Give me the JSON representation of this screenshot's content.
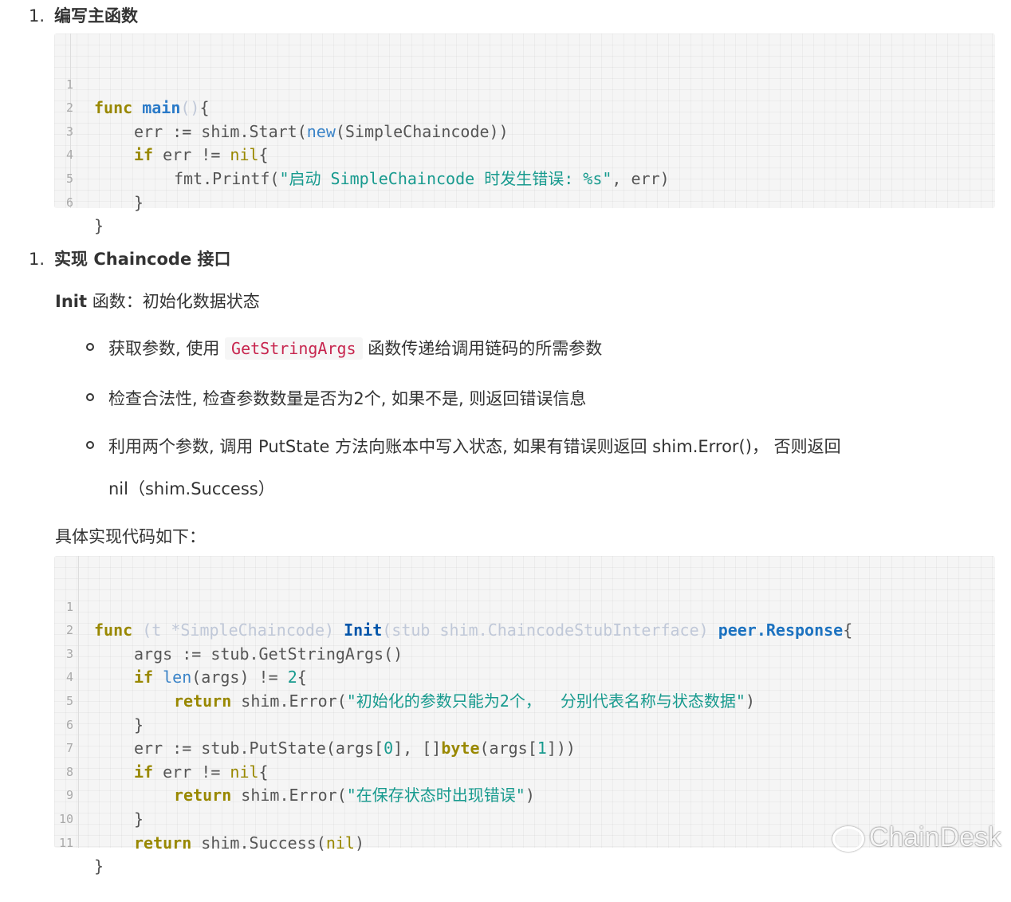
{
  "section1": {
    "number": "1.",
    "title": "编写主函数"
  },
  "code1": {
    "line_numbers": [
      "1",
      "2",
      "3",
      "4",
      "5",
      "6"
    ],
    "l1": {
      "kw": "func",
      "fn": "main",
      "parens": "()",
      "rest": "{"
    },
    "l2": {
      "a": "err := shim.Start(",
      "builtin": "new",
      "b": "(SimpleChaincode))"
    },
    "l3": {
      "kw": "if",
      "a": " err != ",
      "nil": "nil",
      "b": "{"
    },
    "l4": {
      "a": "fmt.Printf(",
      "str": "\"启动 SimpleChaincode 时发生错误: %s\"",
      "b": ", err)"
    },
    "l5": "}",
    "l6": "}"
  },
  "section2": {
    "number": "1.",
    "title": "实现 Chaincode 接口"
  },
  "init_heading": {
    "strong": "Init",
    "rest": " 函数：初始化数据状态"
  },
  "bullets": {
    "b1_before": "获取参数, 使用 ",
    "b1_code": "GetStringArgs",
    "b1_after": " 函数传递给调用链码的所需参数",
    "b2": "检查合法性, 检查参数数量是否为2个, 如果不是, 则返回错误信息",
    "b3": "利用两个参数, 调用 PutState 方法向账本中写入状态, 如果有错误则返回 shim.Error()，  否则返回",
    "b3_cont": "nil（shim.Success）"
  },
  "impl_text": "具体实现代码如下：",
  "code2": {
    "line_numbers": [
      "1",
      "2",
      "3",
      "4",
      "5",
      "6",
      "7",
      "8",
      "9",
      "10",
      "11"
    ],
    "l1": {
      "kw": "func",
      "recv": " (t *SimpleChaincode) ",
      "fn": "Init",
      "params": "(stub shim.ChaincodeStubInterface) ",
      "ret": "peer.Response",
      "b": "{"
    },
    "l2": "args := stub.GetStringArgs()",
    "l3": {
      "kw": "if",
      "sp": " ",
      "builtin": "len",
      "a": "(args) != ",
      "num": "2",
      "b": "{"
    },
    "l4": {
      "kw": "return",
      "a": " shim.Error(",
      "str": "\"初始化的参数只能为2个，  分别代表名称与状态数据\"",
      "b": ")"
    },
    "l5": "}",
    "l6": {
      "a": "err := stub.PutState(args[",
      "n0": "0",
      "b": "], []",
      "type": "byte",
      "c": "(args[",
      "n1": "1",
      "d": "]))"
    },
    "l7": {
      "kw": "if",
      "a": " err != ",
      "nil": "nil",
      "b": "{"
    },
    "l8": {
      "kw": "return",
      "a": " shim.Error(",
      "str": "\"在保存状态时出现错误\"",
      "b": ")"
    },
    "l9": "}",
    "l10": {
      "kw": "return",
      "a": " shim.Success(",
      "nil": "nil",
      "b": ")"
    },
    "l11": "}"
  },
  "watermark": "ChainDesk"
}
